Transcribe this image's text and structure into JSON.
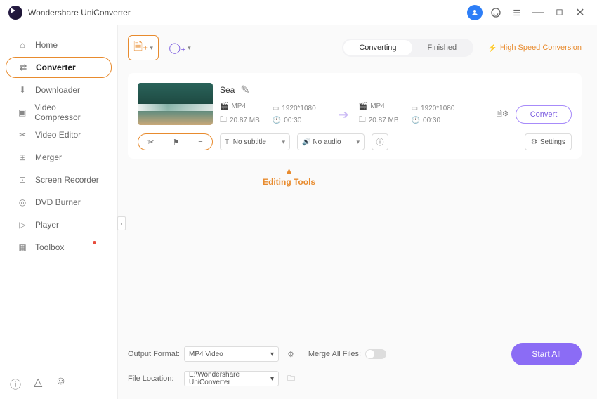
{
  "app": {
    "title": "Wondershare UniConverter"
  },
  "sidebar": {
    "items": [
      {
        "label": "Home"
      },
      {
        "label": "Converter"
      },
      {
        "label": "Downloader"
      },
      {
        "label": "Video Compressor"
      },
      {
        "label": "Video Editor"
      },
      {
        "label": "Merger"
      },
      {
        "label": "Screen Recorder"
      },
      {
        "label": "DVD Burner"
      },
      {
        "label": "Player"
      },
      {
        "label": "Toolbox"
      }
    ]
  },
  "tabs": {
    "converting": "Converting",
    "finished": "Finished"
  },
  "highspeed": "High Speed Conversion",
  "file": {
    "name": "Sea",
    "src_format": "MP4",
    "src_res": "1920*1080",
    "src_size": "20.87 MB",
    "src_dur": "00:30",
    "dst_format": "MP4",
    "dst_res": "1920*1080",
    "dst_size": "20.87 MB",
    "dst_dur": "00:30",
    "subtitle": "No subtitle",
    "audio": "No audio",
    "settings_label": "Settings",
    "convert_label": "Convert"
  },
  "annotation": "Editing Tools",
  "bottom": {
    "output_label": "Output Format:",
    "output_value": "MP4 Video",
    "location_label": "File Location:",
    "location_value": "E:\\Wondershare UniConverter",
    "merge_label": "Merge All Files:",
    "start_all": "Start All"
  }
}
